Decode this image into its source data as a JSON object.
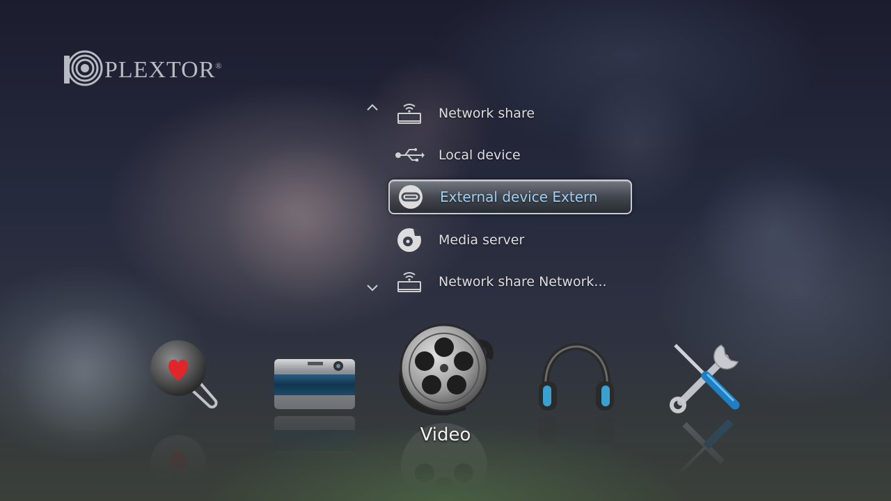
{
  "brand": {
    "logo_text": "PLEXTOR",
    "trademark": "®"
  },
  "menu": {
    "up_arrow_icon": "chevron-up-icon",
    "down_arrow_icon": "chevron-down-icon",
    "items": [
      {
        "label": "Network share",
        "icon": "network-share-icon",
        "selected": false
      },
      {
        "label": "Local device",
        "icon": "usb-icon",
        "selected": false
      },
      {
        "label": "External device Extern",
        "icon": "external-device-icon",
        "selected": true
      },
      {
        "label": "Media server",
        "icon": "media-server-icon",
        "selected": false
      },
      {
        "label": "Network share Network...",
        "icon": "network-share-icon",
        "selected": false
      }
    ]
  },
  "dock": {
    "items": [
      {
        "name": "favorites",
        "icon": "heart-pin-icon"
      },
      {
        "name": "photo",
        "icon": "camera-icon"
      },
      {
        "name": "video",
        "icon": "film-reel-icon",
        "active": true
      },
      {
        "name": "music",
        "icon": "headphones-icon"
      },
      {
        "name": "settings",
        "icon": "tools-icon"
      }
    ],
    "active_label": "Video"
  },
  "colors": {
    "selected_text": "#9ed0f5",
    "menu_text": "#dedede"
  }
}
